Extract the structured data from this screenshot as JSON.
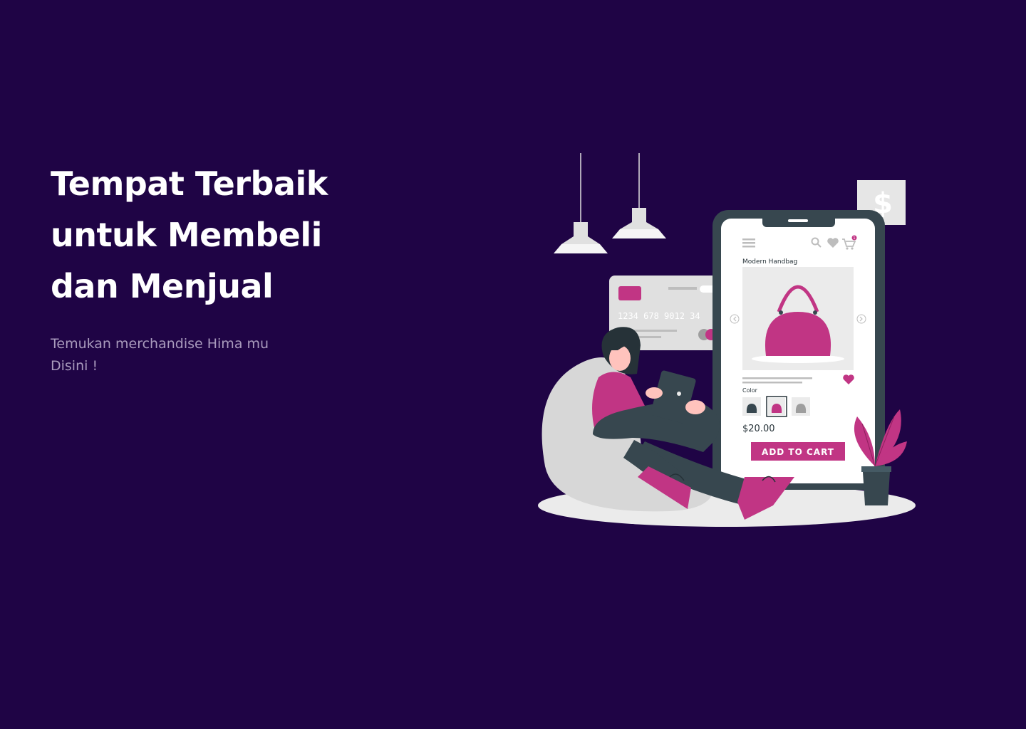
{
  "hero": {
    "title_lines": [
      "Tempat Terbaik",
      "untuk Membeli",
      "dan Menjual"
    ],
    "subtitle_lines": [
      "Temukan merchandise Hima mu",
      "Disini !"
    ]
  },
  "illustration": {
    "product": {
      "name": "Modern Handbag",
      "color_label": "Color",
      "price": "$20.00",
      "add_to_cart_label": "ADD TO CART",
      "cart_count": "1"
    },
    "card": {
      "number": "1234  678  9012  34"
    },
    "price_tag_symbol": "$"
  },
  "colors": {
    "background": "#1f0445",
    "accent": "#c13584",
    "title": "#ffffff",
    "subtitle": "#a99bbd",
    "phone_frame": "#37474f"
  },
  "icons": [
    "menu-icon",
    "search-icon",
    "heart-icon",
    "cart-icon",
    "chevron-left-icon",
    "chevron-right-icon",
    "dollar-icon",
    "lamp-icon",
    "plant-icon"
  ]
}
